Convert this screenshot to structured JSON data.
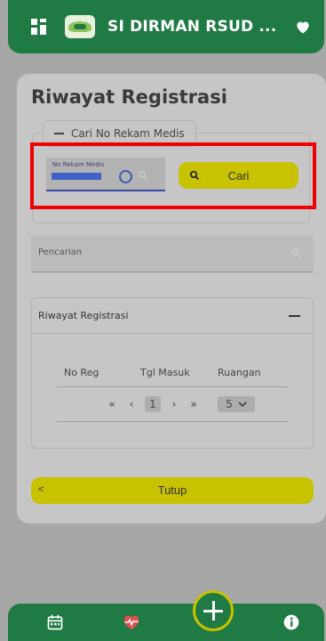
{
  "app": {
    "title": "SI DIRMAN RSUD ..."
  },
  "page": {
    "title": "Riwayat Registrasi"
  },
  "search_form": {
    "legend": "Cari No Rekam Medis",
    "input_label": "No Rekam Medis",
    "input_value": "",
    "button_label": "Cari"
  },
  "filter": {
    "placeholder": "Pencarian"
  },
  "history_panel": {
    "title": "Riwayat Registrasi",
    "columns": [
      "No Reg",
      "Tgl Masuk",
      "Ruangan"
    ],
    "pagination": {
      "first": "«",
      "prev": "‹",
      "current_page": "1",
      "next": "›",
      "last": "»",
      "page_size": "5"
    }
  },
  "close_button": {
    "label": "Tutup"
  },
  "colors": {
    "brand_green": "#1f7a44",
    "accent_yellow": "#c8c200",
    "highlight_red": "#f00000"
  }
}
